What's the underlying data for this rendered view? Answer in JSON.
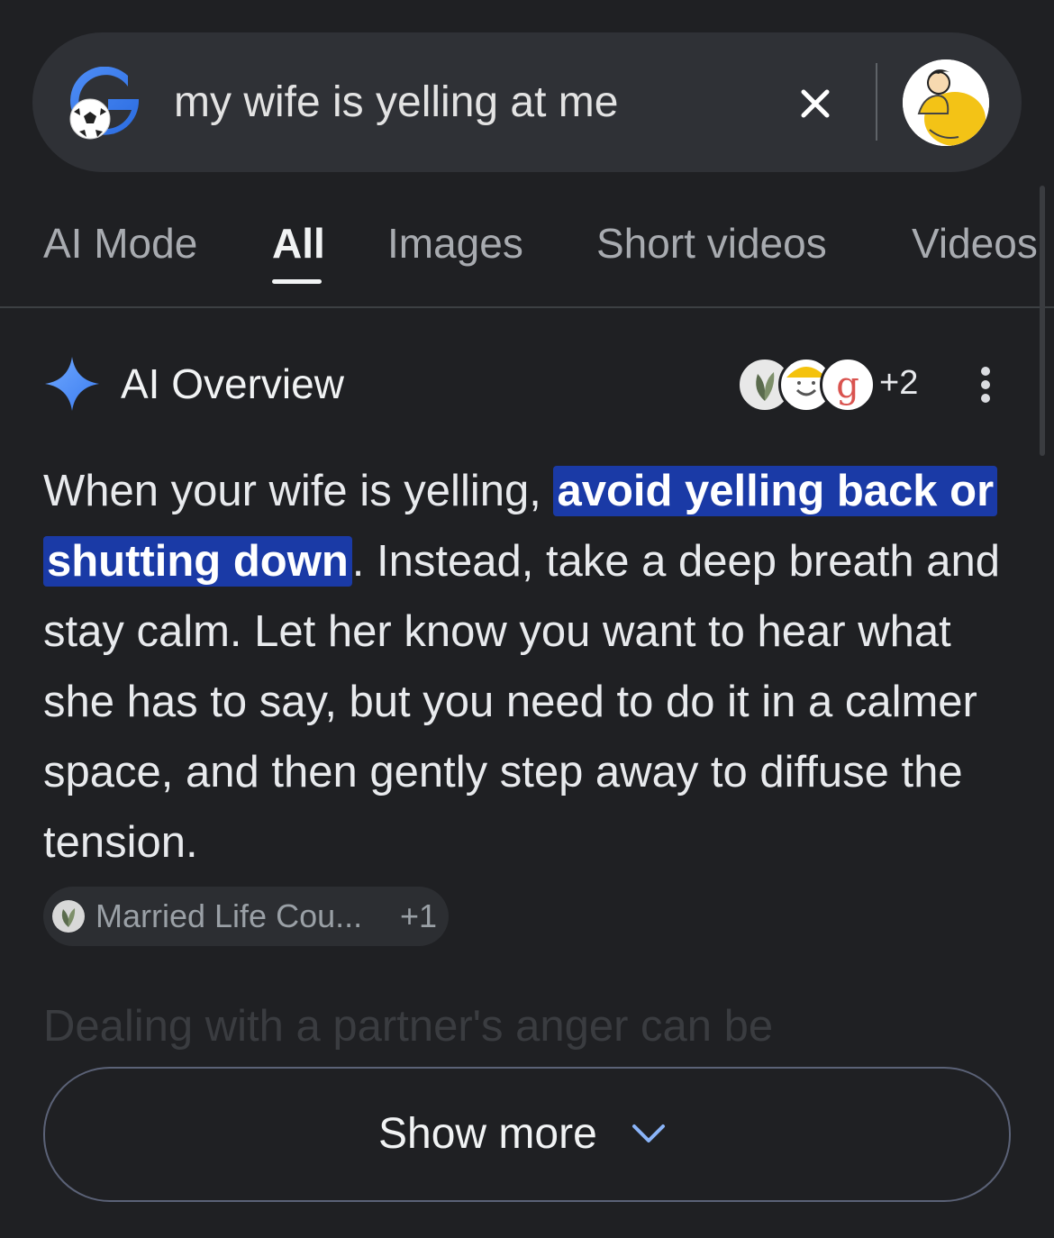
{
  "search": {
    "query": "my wife is yelling at me",
    "clear_icon": "close-icon",
    "logo_icon": "google-soccer-ball-logo",
    "avatar_icon": "profile-avatar"
  },
  "tabs": [
    {
      "label": "AI Mode",
      "active": false
    },
    {
      "label": "All",
      "active": true
    },
    {
      "label": "Images",
      "active": false
    },
    {
      "label": "Short videos",
      "active": false
    },
    {
      "label": "Videos",
      "active": false
    }
  ],
  "ai_overview": {
    "title": "AI Overview",
    "title_icon": "sparkle-icon",
    "sources_extra": "+2",
    "menu_icon": "more-vert-icon",
    "answer_lead": "When your wife is yelling, ",
    "answer_highlight": "avoid yelling back or shutting down",
    "answer_rest": ". Instead, take a deep breath and stay calm. Let her know you want to hear what she has to say, but you need to do it in a calmer space, and then gently step away to diffuse the tension.",
    "citation": {
      "label": "Married Life Cou...",
      "extra": "+1"
    },
    "faded_text": "Dealing with a partner's anger can be",
    "show_more": "Show more",
    "show_more_icon": "chevron-down-icon"
  },
  "colors": {
    "background": "#1f2023",
    "search_bar": "#2f3136",
    "highlight": "#1a3aa6",
    "google_blue": "#4285f4",
    "sparkle": "#4f8ef7"
  }
}
